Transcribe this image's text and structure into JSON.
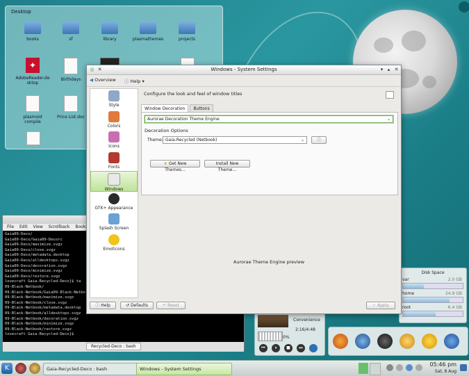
{
  "desktop": {
    "title": "Desktop",
    "icons": [
      {
        "label": "books",
        "kind": "folder"
      },
      {
        "label": "sf",
        "kind": "folder"
      },
      {
        "label": "library",
        "kind": "folder"
      },
      {
        "label": "plasmathemes",
        "kind": "folder"
      },
      {
        "label": "projects",
        "kind": "folder"
      },
      {
        "label": "AdobeReader.de sktop",
        "kind": "pdf"
      },
      {
        "label": "Birthdays",
        "kind": "doc"
      },
      {
        "label": "plasmoid compile",
        "kind": "doc"
      },
      {
        "label": "Price List.doc",
        "kind": "doc"
      }
    ]
  },
  "window": {
    "title": "Windows - System Settings",
    "toolbar": {
      "overview": "Overview",
      "help": "Help"
    },
    "sidebar": [
      {
        "label": "Style",
        "color": "#8fa8c8"
      },
      {
        "label": "Colors",
        "color": "#e07a3f"
      },
      {
        "label": "Icons",
        "color": "#c96fb0"
      },
      {
        "label": "Fonts",
        "color": "#b23a2e"
      },
      {
        "label": "Windows",
        "color": "#e8e8e8",
        "active": true
      },
      {
        "label": "GTK+ Appearance",
        "color": "#2a2a2a"
      },
      {
        "label": "Splash Screen",
        "color": "#6ca0d6"
      },
      {
        "label": "Emoticons",
        "color": "#f2c318"
      }
    ],
    "heading": "Configure the look and feel of window titles",
    "tabs": [
      "Window Decoration",
      "Buttons"
    ],
    "decoration_engine": "Aurorae Decoration Theme Engine",
    "decoration_options_label": "Decoration Options",
    "theme_label": "Theme:",
    "theme_value": "Gaia-Recycled (Netbook)",
    "get_new_themes": "Get New Themes...",
    "install_new_theme": "Install New Theme...",
    "preview_label": "Aurorae Theme Engine preview",
    "footer": {
      "help": "Help",
      "defaults": "Defaults",
      "reset": "Reset",
      "apply": "Apply"
    }
  },
  "terminal": {
    "title": "Gaia-Recycled-Deco : bash",
    "menu": [
      "File",
      "Edit",
      "View",
      "Scrollback",
      "Bookmarks"
    ],
    "lines": [
      "Gaia09-Deco/",
      "Gaia09-Deco/Gaia09-Decorc",
      "Gaia09-Deco/maximize.svgz",
      "Gaia09-Deco/close.svgz",
      "Gaia09-Deco/metadata.desktop",
      "Gaia09-Deco/alldesktops.svgz",
      "Gaia09-Deco/decoration.svgz",
      "Gaia09-Deco/minimize.svgz",
      "Gaia09-Deco/restore.svgz",
      "lovecraft Gaia-Recycled-Deco]$ ta",
      "09-Black-Netbook/",
      "09-Black-Netbook/Gaia09-Black-Netbo",
      "09-Black-Netbook/maximize.svgz",
      "09-Black-Netbook/close.svgz",
      "09-Black-Netbook/metadata.desktop",
      "09-Black-Netbook/alldesktops.svgz",
      "09-Black-Netbook/decoration.svgz",
      "09-Black-Netbook/minimize.svgz",
      "09-Black-Netbook/restore.svgz",
      "lovecraft Gaia-Recycled-Deco]$ "
    ],
    "tab_label": "Recycled-Deco : bash"
  },
  "disk": {
    "title": "Disk Space",
    "entries": [
      {
        "name": "var",
        "size": "2.0 GB",
        "fill": 0.35
      },
      {
        "name": "home",
        "size": "24.9 GB",
        "fill": 0.78
      },
      {
        "name": "root",
        "size": "6.4 GB",
        "fill": 0.55
      }
    ]
  },
  "media": {
    "track": "Convenience",
    "time": "2:16/4:48",
    "volume": "0%"
  },
  "taskbar": {
    "tasks": [
      "Gaia-Recycled-Deco : bash",
      "Windows - System Settings"
    ],
    "time": "05:46 pm",
    "date": "Sat, 8 Aug"
  }
}
